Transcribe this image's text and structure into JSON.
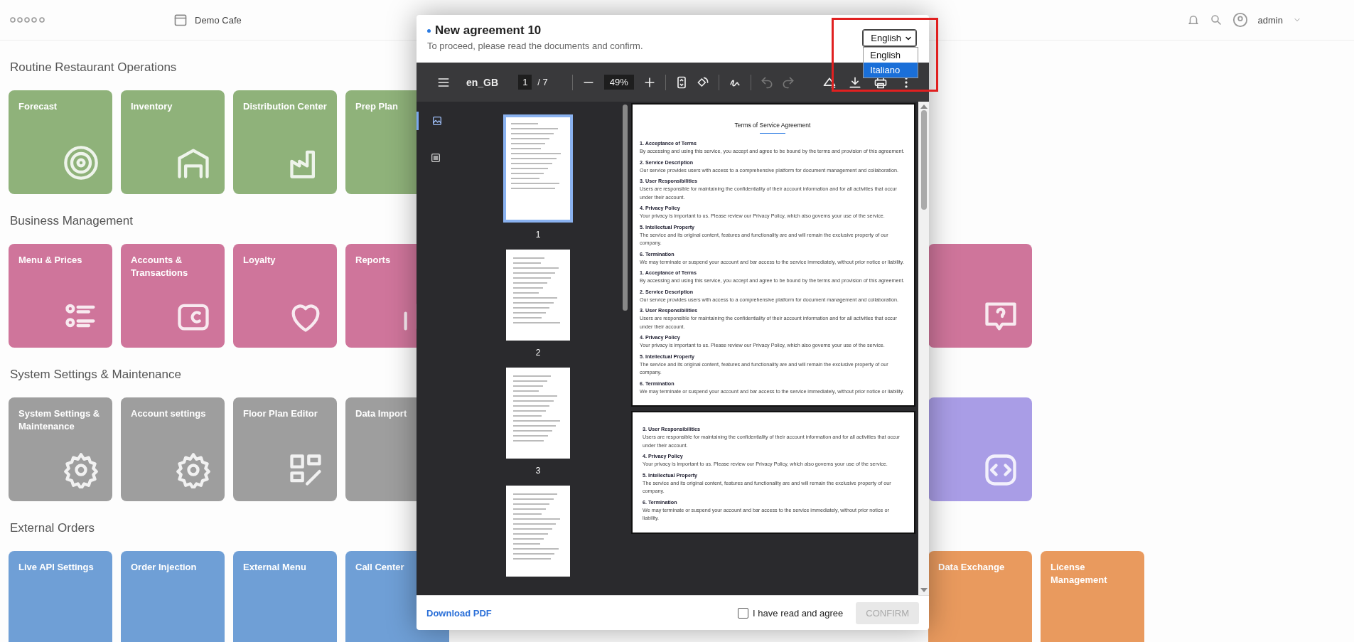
{
  "app_bar": {
    "location": "Demo Cafe",
    "user": "admin"
  },
  "sections": [
    {
      "title": "Routine Restaurant Operations",
      "tiles": [
        {
          "label": "Forecast",
          "kind": "target",
          "color": "#8fb27a"
        },
        {
          "label": "Inventory",
          "kind": "warehouse",
          "color": "#8fb27a"
        },
        {
          "label": "Distribution Center",
          "kind": "factory",
          "color": "#8fb27a"
        },
        {
          "label": "Prep Plan",
          "color": "#8fb27a"
        }
      ]
    },
    {
      "title": "Business Management",
      "tiles": [
        {
          "label": "Menu & Prices",
          "kind": "list",
          "color": "#cf759b"
        },
        {
          "label": "Accounts & Transactions",
          "kind": "wallet",
          "color": "#cf759b"
        },
        {
          "label": "Loyalty",
          "kind": "heart",
          "color": "#cf759b"
        },
        {
          "label": "Reports",
          "kind": "chart",
          "color": "#cf759b"
        }
      ],
      "tiles_beyond_dialog": [
        {
          "kind": "help",
          "color": "#cf759b"
        }
      ]
    },
    {
      "title": "System Settings & Maintenance",
      "tiles": [
        {
          "label": "System Settings & Maintenance",
          "kind": "gear",
          "color": "#9e9e9e"
        },
        {
          "label": "Account settings",
          "kind": "gear",
          "color": "#9e9e9e"
        },
        {
          "label": "Floor Plan Editor",
          "kind": "layout",
          "color": "#9e9e9e"
        },
        {
          "label": "Data Import",
          "color": "#9e9e9e"
        }
      ],
      "tiles_beyond_dialog": [
        {
          "kind": "code",
          "color": "#a99de6"
        }
      ]
    },
    {
      "title": "External Orders",
      "tiles": [
        {
          "label": "Live API Settings",
          "color": "#6f9fd6"
        },
        {
          "label": "Order Injection",
          "color": "#6f9fd6"
        },
        {
          "label": "External Menu",
          "color": "#6f9fd6"
        },
        {
          "label": "Call Center",
          "color": "#6f9fd6"
        }
      ],
      "tiles_beyond_dialog": [
        {
          "label": "Data Exchange",
          "color": "#e99a5e"
        },
        {
          "label": "License Management",
          "color": "#e99a5e"
        }
      ]
    }
  ],
  "dialog": {
    "title": "New agreement 10",
    "subtitle": "To proceed, please read the documents and confirm.",
    "language_select": {
      "value": "English",
      "expanded": true,
      "options": [
        {
          "label": "English",
          "highlighted": false
        },
        {
          "label": "Italiano",
          "highlighted": true
        }
      ]
    },
    "toolbar": {
      "document_name": "en_GB",
      "page": "1",
      "page_count": "/ 7",
      "zoom": "49%",
      "undo_disabled": true,
      "redo_disabled": true
    },
    "sidebar_tabs": [
      {
        "kind": "thumbnails",
        "selected": true
      },
      {
        "kind": "outline",
        "selected": false
      }
    ],
    "thumbnails": [
      {
        "label": "1",
        "selected": true
      },
      {
        "label": "2",
        "selected": false
      },
      {
        "label": "3",
        "selected": false
      },
      {
        "selected": false
      }
    ],
    "pages": [
      {
        "title": "Terms of Service Agreement",
        "clauses": [
          {
            "heading": "1. Acceptance of Terms",
            "text": "By accessing and using this service, you accept and agree to be bound by the terms and provision of this agreement."
          },
          {
            "heading": "2. Service Description",
            "text": "Our service provides users with access to a comprehensive platform for document management and collaboration."
          },
          {
            "heading": "3. User Responsibilities",
            "text": "Users are responsible for maintaining the confidentiality of their account information and for all activities that occur under their account."
          },
          {
            "heading": "4. Privacy Policy",
            "text": "Your privacy is important to us. Please review our Privacy Policy, which also governs your use of the service."
          },
          {
            "heading": "5. Intellectual Property",
            "text": "The service and its original content, features and functionality are and will remain the exclusive property of our company."
          },
          {
            "heading": "6. Termination",
            "text": "We may terminate or suspend your account and bar access to the service immediately, without prior notice or liability."
          },
          {
            "heading": "1. Acceptance of Terms",
            "text": "By accessing and using this service, you accept and agree to be bound by the terms and provision of this agreement."
          },
          {
            "heading": "2. Service Description",
            "text": "Our service provides users with access to a comprehensive platform for document management and collaboration."
          },
          {
            "heading": "3. User Responsibilities",
            "text": "Users are responsible for maintaining the confidentiality of their account information and for all activities that occur under their account."
          },
          {
            "heading": "4. Privacy Policy",
            "text": "Your privacy is important to us. Please review our Privacy Policy, which also governs your use of the service."
          },
          {
            "heading": "5. Intellectual Property",
            "text": "The service and its original content, features and functionality are and will remain the exclusive property of our company."
          },
          {
            "heading": "6. Termination",
            "text": "We may terminate or suspend your account and bar access to the service immediately, without prior notice or liability."
          }
        ]
      },
      {
        "clauses": [
          {
            "heading": "3. User Responsibilities",
            "text": "Users are responsible for maintaining the confidentiality of their account information and for all activities that occur under their account."
          },
          {
            "heading": "4. Privacy Policy",
            "text": "Your privacy is important to us. Please review our Privacy Policy, which also governs your use of the service."
          },
          {
            "heading": "5. Intellectual Property",
            "text": "The service and its original content, features and functionality are and will remain the exclusive property of our company."
          },
          {
            "heading": "6. Termination",
            "text": "We may terminate or suspend your account and bar access to the service immediately, without prior notice or liability."
          }
        ]
      }
    ],
    "footer": {
      "download_link": "Download PDF",
      "agree": {
        "label": "I have read and agree",
        "checked": false
      },
      "confirm": {
        "label": "CONFIRM",
        "disabled": true
      }
    }
  }
}
